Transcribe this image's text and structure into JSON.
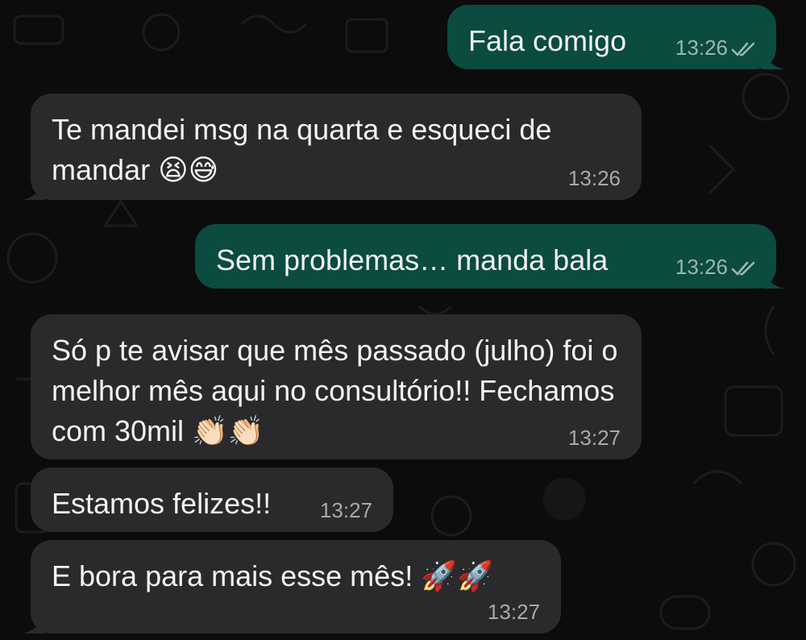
{
  "messages": [
    {
      "direction": "out",
      "text": "Fala comigo",
      "time": "13:26",
      "status": "read"
    },
    {
      "direction": "in",
      "text": "Te mandei msg na quarta e esqueci de mandar 😫😅",
      "time": "13:26"
    },
    {
      "direction": "out",
      "text": "Sem problemas… manda bala",
      "time": "13:26",
      "status": "read"
    },
    {
      "direction": "in",
      "text": "Só p te avisar que mês passado (julho) foi o melhor mês aqui no consultório!! Fechamos com 30mil 👏🏻👏🏻",
      "time": "13:27"
    },
    {
      "direction": "in",
      "text": "Estamos felizes!!",
      "time": "13:27"
    },
    {
      "direction": "in",
      "text": "E bora para mais esse mês! 🚀🚀",
      "time": "13:27"
    }
  ],
  "colors": {
    "incoming_bubble": "#2a2a2c",
    "outgoing_bubble": "#0b4b40",
    "read_ticks": "#9bb7b1",
    "background": "#0b0b0b"
  },
  "icons": {
    "read_receipt": "double-check-icon"
  }
}
